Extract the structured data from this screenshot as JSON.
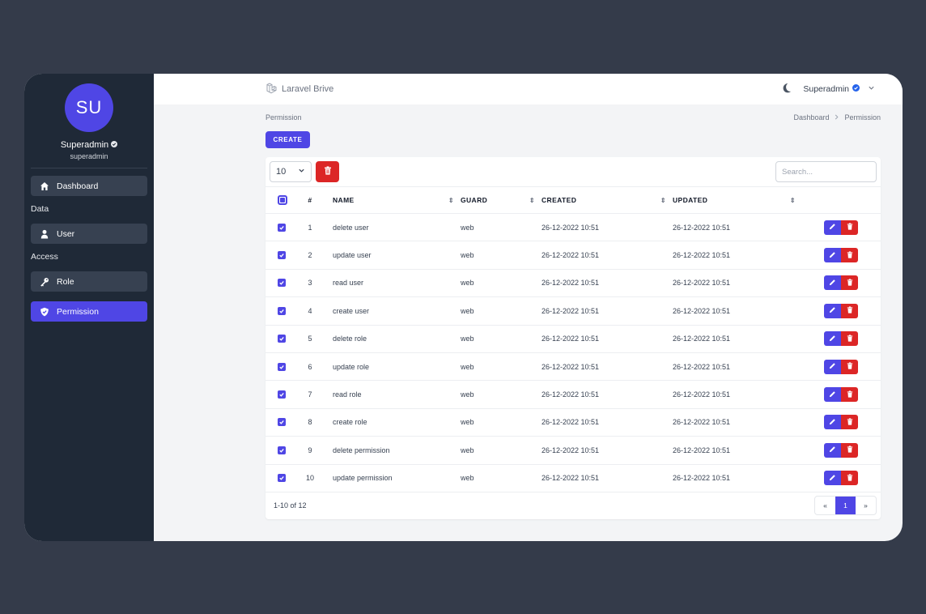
{
  "brand": {
    "name": "Laravel Brive",
    "icon": "laravel-logo-icon"
  },
  "profile": {
    "initials": "SU",
    "name": "Superadmin",
    "username": "superadmin",
    "verified_icon": "verified-badge-icon"
  },
  "sidebar": {
    "dashboard": {
      "label": "Dashboard",
      "icon": "home-icon"
    },
    "section_data": "Data",
    "user": {
      "label": "User",
      "icon": "user-icon"
    },
    "section_access": "Access",
    "role": {
      "label": "Role",
      "icon": "key-icon"
    },
    "permission": {
      "label": "Permission",
      "icon": "shield-icon"
    }
  },
  "topbar": {
    "user_name": "Superadmin",
    "theme_icon": "moon-icon"
  },
  "page": {
    "title": "Permission",
    "breadcrumb": [
      "Dashboard",
      "Permission"
    ],
    "create_label": "CREATE"
  },
  "toolbar": {
    "per_page": "10",
    "search_placeholder": "Search..."
  },
  "table": {
    "headers": {
      "num": "#",
      "name": "NAME",
      "guard": "GUARD",
      "created": "CREATED",
      "updated": "UPDATED"
    },
    "rows": [
      {
        "num": "1",
        "name": "delete user",
        "guard": "web",
        "created": "26-12-2022 10:51",
        "updated": "26-12-2022 10:51"
      },
      {
        "num": "2",
        "name": "update user",
        "guard": "web",
        "created": "26-12-2022 10:51",
        "updated": "26-12-2022 10:51"
      },
      {
        "num": "3",
        "name": "read user",
        "guard": "web",
        "created": "26-12-2022 10:51",
        "updated": "26-12-2022 10:51"
      },
      {
        "num": "4",
        "name": "create user",
        "guard": "web",
        "created": "26-12-2022 10:51",
        "updated": "26-12-2022 10:51"
      },
      {
        "num": "5",
        "name": "delete role",
        "guard": "web",
        "created": "26-12-2022 10:51",
        "updated": "26-12-2022 10:51"
      },
      {
        "num": "6",
        "name": "update role",
        "guard": "web",
        "created": "26-12-2022 10:51",
        "updated": "26-12-2022 10:51"
      },
      {
        "num": "7",
        "name": "read role",
        "guard": "web",
        "created": "26-12-2022 10:51",
        "updated": "26-12-2022 10:51"
      },
      {
        "num": "8",
        "name": "create role",
        "guard": "web",
        "created": "26-12-2022 10:51",
        "updated": "26-12-2022 10:51"
      },
      {
        "num": "9",
        "name": "delete permission",
        "guard": "web",
        "created": "26-12-2022 10:51",
        "updated": "26-12-2022 10:51"
      },
      {
        "num": "10",
        "name": "update permission",
        "guard": "web",
        "created": "26-12-2022 10:51",
        "updated": "26-12-2022 10:51"
      }
    ]
  },
  "footer": {
    "range": "1-10 of 12",
    "pager": {
      "prev": "«",
      "current": "1",
      "next": "»"
    }
  },
  "colors": {
    "accent": "#4f46e5",
    "danger": "#dc2626",
    "sidebar": "#1f2937",
    "backdrop": "#343b4a"
  }
}
